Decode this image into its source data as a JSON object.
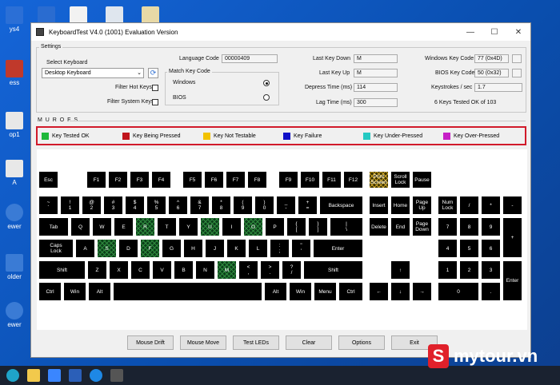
{
  "desktop": {
    "icons": [
      {
        "label": "ys4",
        "color": "#2b6fd6"
      },
      {
        "label": "ess",
        "color": "#c0392b"
      },
      {
        "label": "op1",
        "color": "#e8e8e8"
      },
      {
        "label": "A",
        "color": "#e8e8e8"
      },
      {
        "label": "ewer",
        "color": "#3a7bd5"
      },
      {
        "label": "older",
        "color": "#3a7bd5"
      },
      {
        "label": "ewer",
        "color": "#3a7bd5"
      }
    ]
  },
  "window": {
    "title": "KeyboardTest V4.0 (1001) Evaluation Version",
    "controls": {
      "minimize": "—",
      "maximize": "☐",
      "close": "✕"
    }
  },
  "settings": {
    "group_label": "Settings",
    "select_keyboard_label": "Select Keyboard",
    "select_keyboard_value": "Desktop Keyboard",
    "filter_hot_keys": "Filter Hot Keys",
    "filter_system_keys": "Filter System Keys",
    "language_code_label": "Language Code",
    "language_code_value": "00000409",
    "match_key_code_label": "Match Key Code",
    "windows_label": "Windows",
    "bios_label": "BIOS",
    "last_key_down_label": "Last Key Down",
    "last_key_down_value": "M",
    "last_key_up_label": "Last Key Up",
    "last_key_up_value": "M",
    "depress_time_label": "Depress Time (ms)",
    "depress_time_value": "114",
    "lag_time_label": "Lag Time (ms)",
    "lag_time_value": "300",
    "windows_key_code_label": "Windows Key Code",
    "windows_key_code_value": "77 (0x4D)",
    "bios_key_code_label": "BIOS Key Code",
    "bios_key_code_value": "50 (0x32)",
    "keystrokes_label": "Keystrokes / sec",
    "keystrokes_value": "1.7",
    "tested_summary": "6 Keys Tested OK of 103"
  },
  "colors": {
    "tested_ok": "#1fb83a",
    "being_pressed": "#c0141c",
    "not_testable": "#f2c200",
    "failure": "#1010c8",
    "under_pressed": "#25c9c2",
    "over_pressed": "#c61fc6"
  },
  "section_label": "M U R O F S",
  "legend": [
    {
      "label": "Key Tested OK",
      "color": "#1fb83a"
    },
    {
      "label": "Key Being Pressed",
      "color": "#c0141c"
    },
    {
      "label": "Key Not Testable",
      "color": "#f2c200"
    },
    {
      "label": "Key Failure",
      "color": "#1010c8"
    },
    {
      "label": "Key Under-Pressed",
      "color": "#25c9c2"
    },
    {
      "label": "Key Over-Pressed",
      "color": "#c61fc6"
    }
  ],
  "keys": {
    "esc": "Esc",
    "f1": "F1",
    "f2": "F2",
    "f3": "F3",
    "f4": "F4",
    "f5": "F5",
    "f6": "F6",
    "f7": "F7",
    "f8": "F8",
    "f9": "F9",
    "f10": "F10",
    "f11": "F11",
    "f12": "F12",
    "prtsc": "Print\nScreen",
    "scroll": "Scroll\nLock",
    "pause": "Pause",
    "tilde": "~\n`",
    "n1": "!\n1",
    "n2": "@\n2",
    "n3": "#\n3",
    "n4": "$\n4",
    "n5": "%\n5",
    "n6": "^\n6",
    "n7": "&\n7",
    "n8": "*\n8",
    "n9": "(\n9",
    "n0": ")\n0",
    "minus": "_\n-",
    "plus": "+\n=",
    "backspace": "Backspace",
    "insert": "Insert",
    "home": "Home",
    "pgup": "Page\nUp",
    "numlock": "Num\nLock",
    "npdiv": "/",
    "npmul": "*",
    "npsub": "-",
    "tab": "Tab",
    "q": "Q",
    "w": "W",
    "e": "E",
    "r": "R",
    "t": "T",
    "y": "Y",
    "u": "U",
    "i": "I",
    "o": "O",
    "p": "P",
    "lbr": "{\n[",
    "rbr": "}\n]",
    "bsl": "|\n\\",
    "delete": "Delete",
    "end": "End",
    "pgdn": "Page\nDown",
    "np7": "7",
    "np8": "8",
    "np9": "9",
    "npplus": "+",
    "caps": "Caps\nLock",
    "a": "A",
    "s": "S",
    "d": "D",
    "f": "F",
    "g": "G",
    "h": "H",
    "j": "J",
    "k": "K",
    "l": "L",
    "semi": ":\n;",
    "quote": "\"\n'",
    "enter": "Enter",
    "np4": "4",
    "np5": "5",
    "np6": "6",
    "lshift": "Shift",
    "z": "Z",
    "x": "X",
    "c": "C",
    "v": "V",
    "b": "B",
    "n": "N",
    "m": "M",
    "comma": "<\n,",
    "period": ">\n.",
    "slash": "?\n/",
    "rshift": "Shift",
    "up": "↑",
    "np1": "1",
    "np2": "2",
    "np3": "3",
    "npenter": "Enter",
    "lctrl": "Ctrl",
    "lwin": "Win",
    "lalt": "Alt",
    "space": "",
    "ralt": "Alt",
    "rwin": "Win",
    "menu": "Menu",
    "rctrl": "Ctrl",
    "left": "←",
    "down": "↓",
    "right": "→",
    "np0": "0",
    "npdot": "."
  },
  "buttons": {
    "mouse_drift": "Mouse Drift",
    "mouse_move": "Mouse Move",
    "test_leds": "Test LEDs",
    "clear": "Clear",
    "options": "Options",
    "exit": "Exit"
  },
  "watermark": {
    "logo_letter": "S",
    "text": "mytour.vn"
  }
}
